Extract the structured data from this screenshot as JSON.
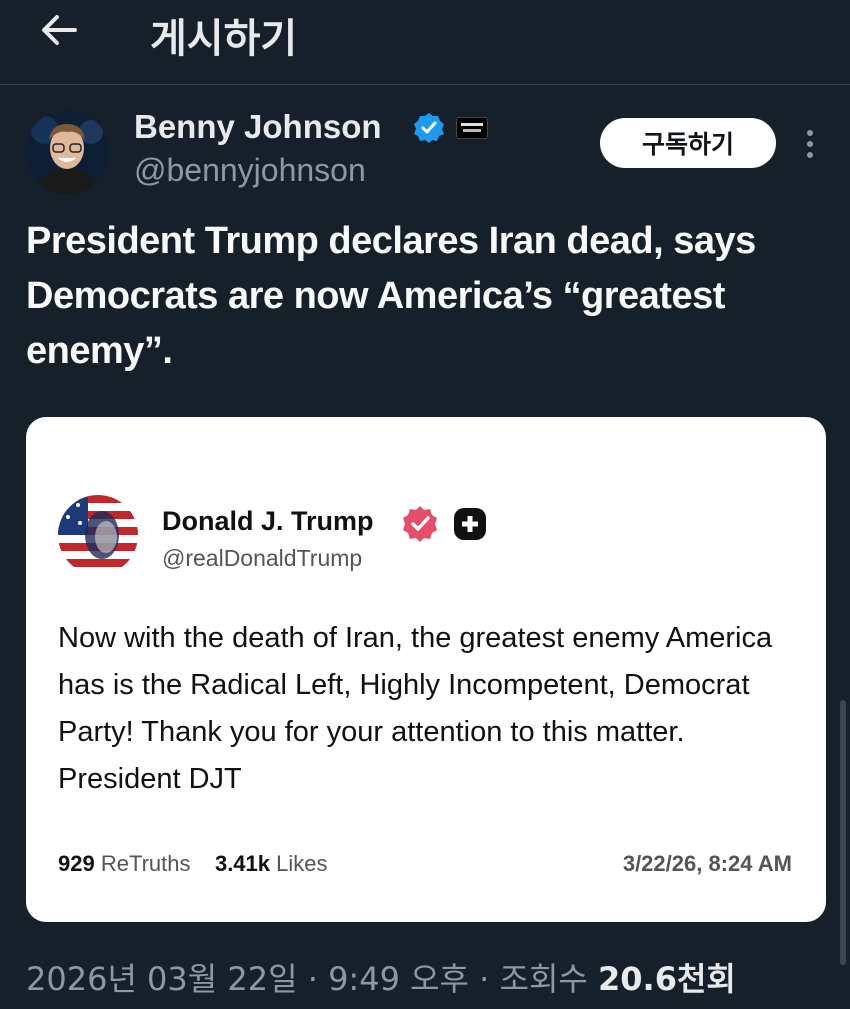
{
  "header": {
    "back_icon": "arrow-left-icon",
    "title": "게시하기"
  },
  "author": {
    "name": "Benny Johnson",
    "handle": "@bennyjohnson",
    "verified_color": "#1d9bf0",
    "subscribe_label": "구독하기"
  },
  "tweet": {
    "text": "President Trump declares Iran dead, says Democrats are now America’s “greatest enemy”."
  },
  "embed": {
    "name": "Donald J. Trump",
    "handle": "@realDonaldTrump",
    "verified_color": "#e64d6b",
    "body": "Now with the death of Iran, the greatest enemy America has is the Radical Left, Highly Incompetent, Democrat Party! Thank you for your attention to this matter. President DJT",
    "retruths_count": "929",
    "retruths_label": "ReTruths",
    "likes_count": "3.41k",
    "likes_label": "Likes",
    "date": "3/22/26, 8:24 AM"
  },
  "meta": {
    "date": "2026년 03월 22일",
    "separator": "·",
    "time": "9:49 오후",
    "views_label": "조회수",
    "views_count": "20.6천회"
  }
}
